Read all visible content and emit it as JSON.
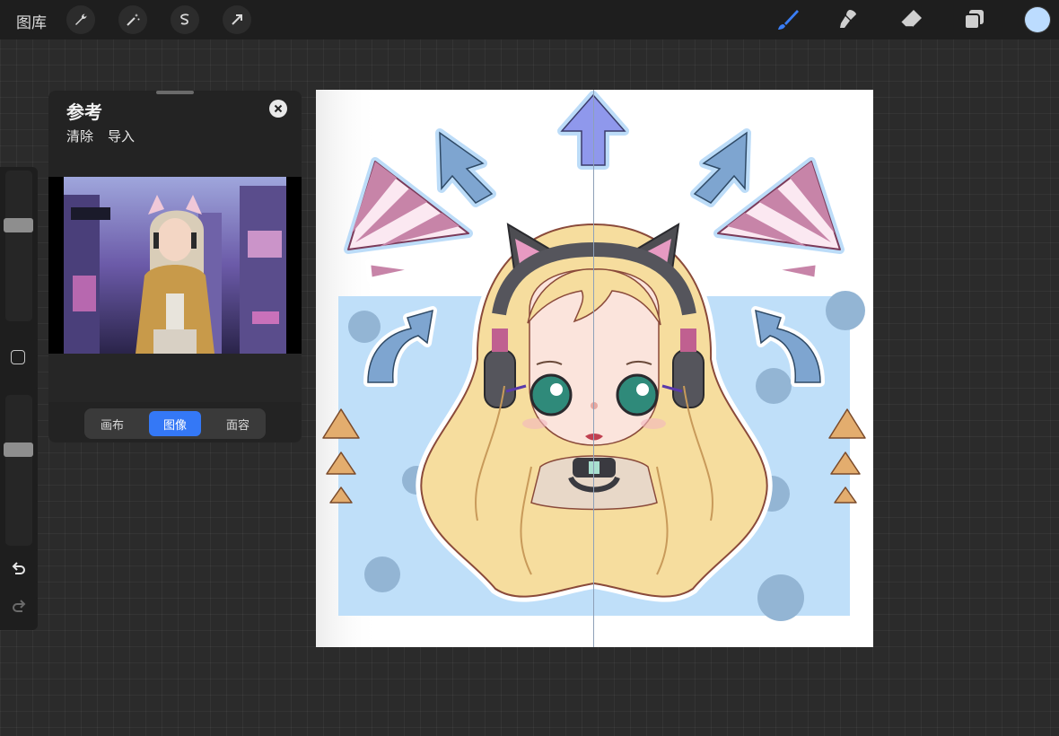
{
  "topbar": {
    "gallery_label": "图库",
    "actions": [
      "wrench-icon",
      "magic-wand-icon",
      "selection-icon",
      "transform-arrow-icon"
    ],
    "tools": [
      "brush-icon",
      "smudge-icon",
      "eraser-icon",
      "layers-icon"
    ],
    "current_color": "#bcdcff",
    "active_tool_color": "#3a7ef6"
  },
  "sidebar": {
    "brush_size_level": 0.35,
    "opacity_level": 0.35,
    "undo_icon": "undo-icon",
    "redo_icon": "redo-icon"
  },
  "reference": {
    "title": "参考",
    "clear_label": "清除",
    "import_label": "导入",
    "tabs": [
      {
        "label": "画布",
        "active": false
      },
      {
        "label": "图像",
        "active": true
      },
      {
        "label": "面容",
        "active": false
      }
    ]
  },
  "colors": {
    "accent": "#3478f6",
    "canvas_bg_blue": "#bfdff9",
    "arrow_blue": "#7ea5d0",
    "arrow_purple": "#8f98ec",
    "stripe_pink": "#c784a8",
    "triangle_orange": "#e3ad6e",
    "hair": "#f6dd9e"
  }
}
